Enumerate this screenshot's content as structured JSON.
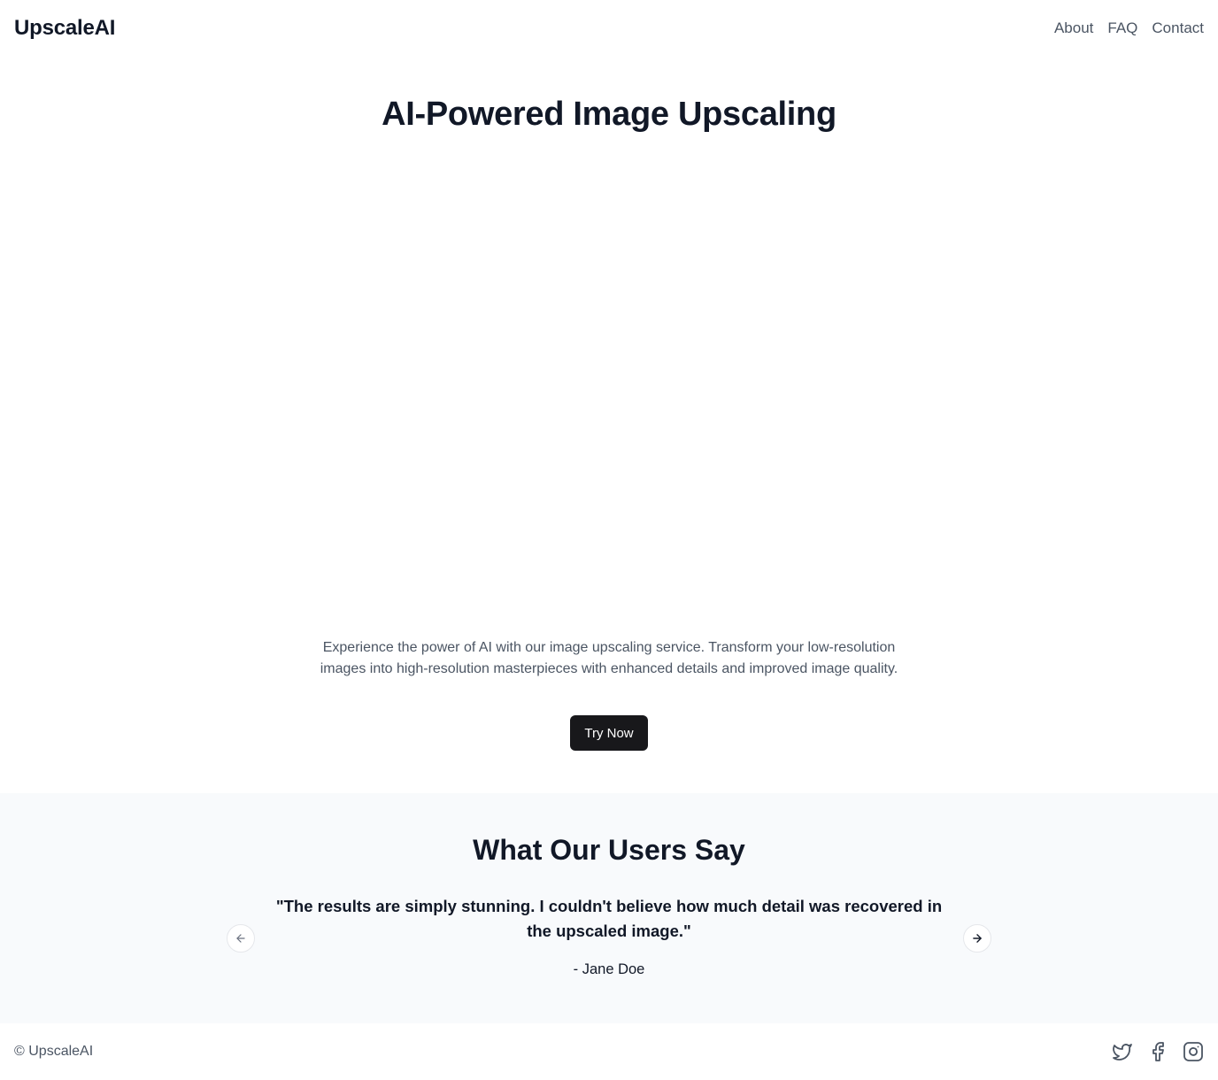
{
  "header": {
    "logo": "UpscaleAI",
    "nav": [
      {
        "label": "About"
      },
      {
        "label": "FAQ"
      },
      {
        "label": "Contact"
      }
    ]
  },
  "hero": {
    "title": "AI-Powered Image Upscaling",
    "description": "Experience the power of AI with our image upscaling service. Transform your low-resolution images into high-resolution masterpieces with enhanced details and improved image quality.",
    "cta_label": "Try Now"
  },
  "testimonials": {
    "title": "What Our Users Say",
    "quote": "\"The results are simply stunning. I couldn't believe how much detail was recovered in the upscaled image.\"",
    "author": "- Jane Doe",
    "prev_icon": "arrow-left-icon",
    "next_icon": "arrow-right-icon"
  },
  "footer": {
    "copyright": "© UpscaleAI",
    "socials": [
      "twitter-icon",
      "facebook-icon",
      "instagram-icon"
    ]
  },
  "colors": {
    "primary_button": "#18181b",
    "testimonial_bg": "#f8fafc",
    "text_dark": "#111827",
    "text_muted": "#4b5563"
  }
}
